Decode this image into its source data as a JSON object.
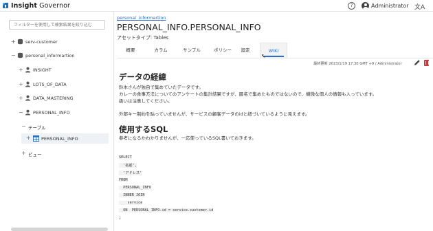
{
  "header": {
    "brand_bold": "Insight",
    "brand_rest": " Governor",
    "help_icon": "?",
    "user_name": "Administrator",
    "lang_icon": "文A"
  },
  "sidebar": {
    "search_placeholder": "フィルターを使用して検索結果を絞り込む",
    "items": [
      {
        "label": "serv-customer",
        "icon": "database-icon"
      },
      {
        "label": "personal_informartion",
        "icon": "database-icon"
      },
      {
        "label": "INSIGHT",
        "icon": "user-icon"
      },
      {
        "label": "LOTS_OF_DATA",
        "icon": "user-icon"
      },
      {
        "label": "DATA_MASTERING",
        "icon": "user-icon"
      },
      {
        "label": "PERSONAL_INFO",
        "icon": "user-icon"
      },
      {
        "label": "テーブル",
        "icon": ""
      },
      {
        "label": "PERSONAL_INFO",
        "icon": "table-icon"
      },
      {
        "label": "ビュー",
        "icon": ""
      }
    ]
  },
  "main": {
    "breadcrumb": "personal_informartion",
    "title": "PERSONAL_INFO.PERSONAL_INFO",
    "asset_type": "アセットタイプ: Tables",
    "tabs": [
      "概要",
      "カラム",
      "サンプル",
      "ポリシー",
      "設定",
      "WIKI"
    ],
    "active_tab": "WIKI",
    "last_updated": "最終更新 2023/1/19 17:30 GMT +9 / Administrator",
    "section1_title": "データの経緯",
    "section1_lines": [
      "鈴木さんが独自で集めていたデータです。",
      "カレーの食事方法についてのアンケートの集計結果ですが、匿名で集めたものではないので、機微な個人の情報も入っています。",
      "扱いは注意してください。",
      "外部キー制約を貼っていませんが、サービスの顧客データのidと紐づいているように見えます。"
    ],
    "section2_title": "使用するSQL",
    "section2_line": "参考になるかわかりませんが、一応使っているSQL書いておきます。",
    "sql_lines": [
      "SELECT",
      "  '名前',",
      "  'アドレス'",
      "FROM",
      "  PERSONAL_INFO",
      "  INNER JOIN",
      "    service",
      "  ON  PERSONAL_INFO.id = service.customer.id",
      ";"
    ]
  }
}
